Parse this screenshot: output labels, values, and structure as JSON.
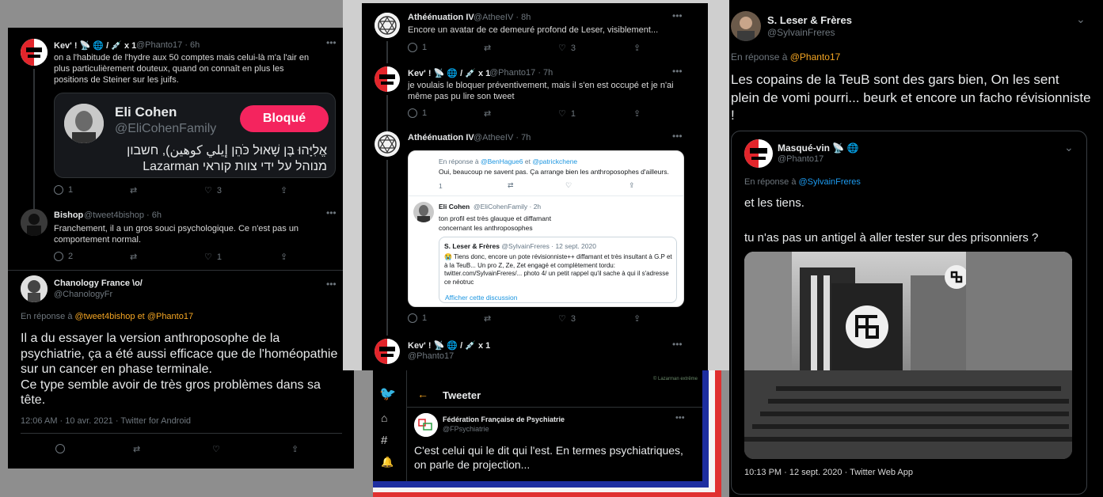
{
  "p1": {
    "t1": {
      "name": "Kev' ! 📡 🌐 / 💉 x 1",
      "handle": "@Phanto17 · 6h",
      "text": "on a l'habitude de l'hydre aux 50 comptes mais celui-là m'a l'air en plus particulièrement douteux, quand on connaît en plus les positions de Steiner sur les juifs.",
      "replies": "1",
      "likes": "3"
    },
    "card": {
      "name": "Eli Cohen",
      "handle": "@EliCohenFamily",
      "button": "Bloqué",
      "bio_line1": "אֱלִיָּהוּ בֶּן שָׁאוּל כֹּהֵן إيلي كوهين), חשבון",
      "bio_line2": "מנוהל על ידי צוות קוראי Lazarman"
    },
    "t2": {
      "name": "Bishop",
      "handle": "@tweet4bishop · 6h",
      "text": "Franchement, il a un gros souci psychologique. Ce n'est pas un comportement normal.",
      "replies": "2",
      "likes": "1"
    },
    "t3": {
      "name": "Chanology France \\o/",
      "handle": "@ChanologyFr",
      "reply_prefix": "En réponse à",
      "reply_to1": "@tweet4bishop",
      "reply_and": "et",
      "reply_to2": "@Phanto17",
      "text": "Il a du essayer la version anthroposophe de la psychiatrie, ça a été aussi efficace que de l'homéopathie sur un cancer en phase terminale.\nCe type semble avoir de très gros problèmes dans sa tête.",
      "meta": "12:06 AM · 10 avr. 2021 · Twitter for Android"
    }
  },
  "p2": {
    "t1": {
      "name": "Athéénuation IV",
      "handle": "@AtheeIV · 8h",
      "text": "Encore un avatar de ce demeuré profond de Leser, visiblement...",
      "replies": "1",
      "likes": "3"
    },
    "t2": {
      "name": "Kev' ! 📡 🌐 / 💉 x 1",
      "handle": "@Phanto17 · 7h",
      "text": "je voulais le bloquer préventivement, mais il s'en est occupé et je n'ai même pas pu lire son tweet",
      "replies": "1",
      "likes": "1"
    },
    "t3": {
      "name": "Athéénuation IV",
      "handle": "@AtheeIV · 7h",
      "replies": "1",
      "likes": "3"
    },
    "shot": {
      "reply_prefix": "En réponse à",
      "reply_to1": "@BenHague6",
      "reply_and": "et",
      "reply_to2": "@patrickchene",
      "q1_text": "Oui, beaucoup ne savent pas. Ça arrange bien les anthroposophes d'ailleurs.",
      "q1_replies": "1",
      "eli_name": "Eli Cohen",
      "eli_handle": "@EliCohenFamily · 2h",
      "eli_text": "ton profil est très glauque et diffamant concernant les anthroposophes",
      "quote_name": "S. Leser & Frères",
      "quote_handle": "@SylvainFreres · 12 sept. 2020",
      "quote_text": "😭 Tiens donc, encore un pote révisionniste++ diffamant et très insultant à G.P et à la TeuB... Un pro Z, Ze, Zet engagé et complètement tordu: twitter.com/SylvainFreres/... photo 4/ un petit rappel qu'il sache à qui il s'adresse ce néotruc",
      "show_thread": "Afficher cette discussion"
    },
    "t4": {
      "name": "Kev' ! 📡 🌐 / 💉 x 1",
      "handle": "@Phanto17"
    }
  },
  "p3": {
    "title": "Tweeter",
    "watermark": "© Lazarman extrême",
    "name": "Fédération Française de Psychiatrie",
    "handle": "@FPsychiatrie",
    "text": "C'est celui qui le dit qui l'est. En termes psychiatriques, on parle de projection..."
  },
  "p4": {
    "name": "S. Leser & Frères",
    "handle": "@SylvainFreres",
    "reply_prefix": "En réponse à",
    "reply_to": "@Phanto17",
    "text": "Les copains de la TeuB sont des gars bien, On les sent plein de vomi pourri... beurk et encore un facho révisionniste !",
    "quote": {
      "name": "Masqué-vin 📡 🌐",
      "handle": "@Phanto17",
      "reply_prefix": "En réponse à",
      "reply_to": "@SylvainFreres",
      "text1": "et les tiens.",
      "text2": "tu n'as pas un antigel à aller tester sur des prisonniers ?",
      "meta": "10:13 PM · 12 sept. 2020 · Twitter Web App"
    }
  },
  "colors": {
    "bg": "#000000",
    "accent": "#1d9bf0",
    "reply_link": "#f5a623",
    "blocked": "#f4245e"
  },
  "icons": [
    "reply-icon",
    "retweet-icon",
    "like-icon",
    "share-icon",
    "more-icon",
    "back-arrow-icon",
    "twitter-bird-icon",
    "search-icon",
    "hashtag-icon",
    "bell-icon"
  ]
}
